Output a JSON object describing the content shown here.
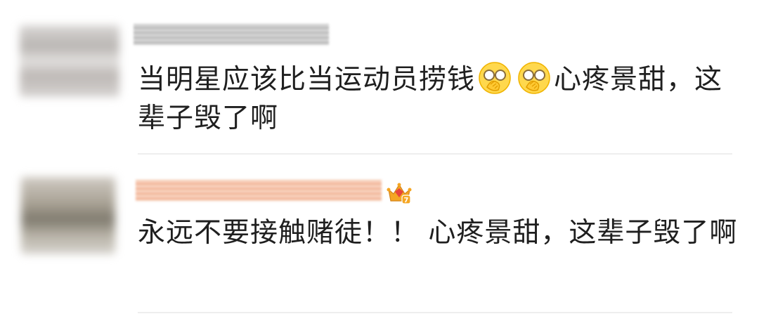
{
  "comments": [
    {
      "username": "",
      "text_part1": "当明星应该比当运动员捞钱",
      "emoji": [
        "face-palm-emoji",
        "face-palm-emoji"
      ],
      "text_part2": "心疼景甜，这辈子毁了啊"
    },
    {
      "username": "",
      "badge": {
        "icon": "crown-badge-icon",
        "level": "7"
      },
      "text": "永远不要接触赌徒！！ 心疼景甜，这辈子毁了啊"
    }
  ],
  "colors": {
    "text": "#1f1f1f",
    "divider": "#eeeeee",
    "badge_gold": "#f5a623",
    "badge_red": "#e8453c"
  }
}
